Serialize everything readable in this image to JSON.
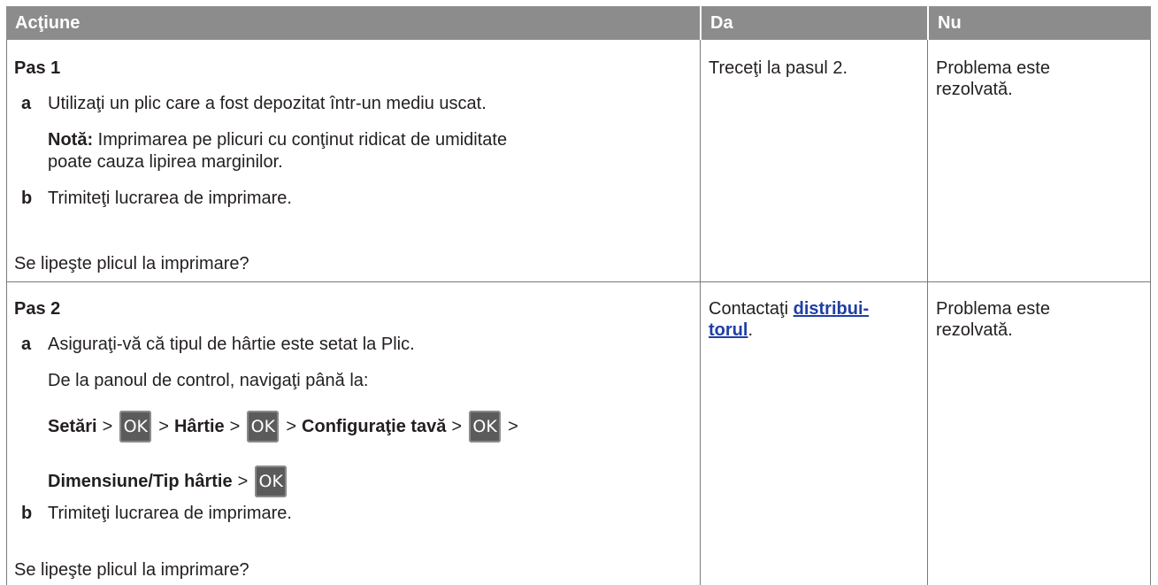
{
  "table": {
    "headers": [
      "Acţiune",
      "Da",
      "Nu"
    ]
  },
  "step1": {
    "title": "Pas 1",
    "a_letter": "a",
    "a_text": "Utilizaţi un plic care a fost depozitat într-un mediu uscat.",
    "note_label": "Notă:",
    "note_text_line1": " Imprimarea pe plicuri cu conţinut ridicat de umiditate",
    "note_text_line2": "poate cauza lipirea marginilor.",
    "b_letter": "b",
    "b_text": "Trimiteţi lucrarea de imprimare.",
    "question": "Se lipeşte plicul la imprimare?",
    "yes": "Treceţi la pasul 2.",
    "no_line1": "Problema este",
    "no_line2": "rezolvată."
  },
  "step2": {
    "title": "Pas 2",
    "a_letter": "a",
    "a_text": "Asiguraţi-vă că tipul de hârtie este setat la Plic.",
    "nav_text": "De la panoul de control, navigaţi până la:",
    "nav": {
      "setari": "Setări",
      "gt": ">",
      "ok": "OK",
      "hartie": "Hârtie",
      "config": "Configuraţie tavă",
      "dim": "Dimensiune/Tip hârtie"
    },
    "b_letter": "b",
    "b_text": "Trimiteţi lucrarea de imprimare.",
    "question": "Se lipeşte plicul la imprimare?",
    "yes_prefix": "Contactaţi ",
    "yes_link_line1": "distribui-",
    "yes_link_line2": "torul",
    "yes_suffix": ".",
    "no_line1": "Problema este",
    "no_line2": "rezolvată."
  }
}
